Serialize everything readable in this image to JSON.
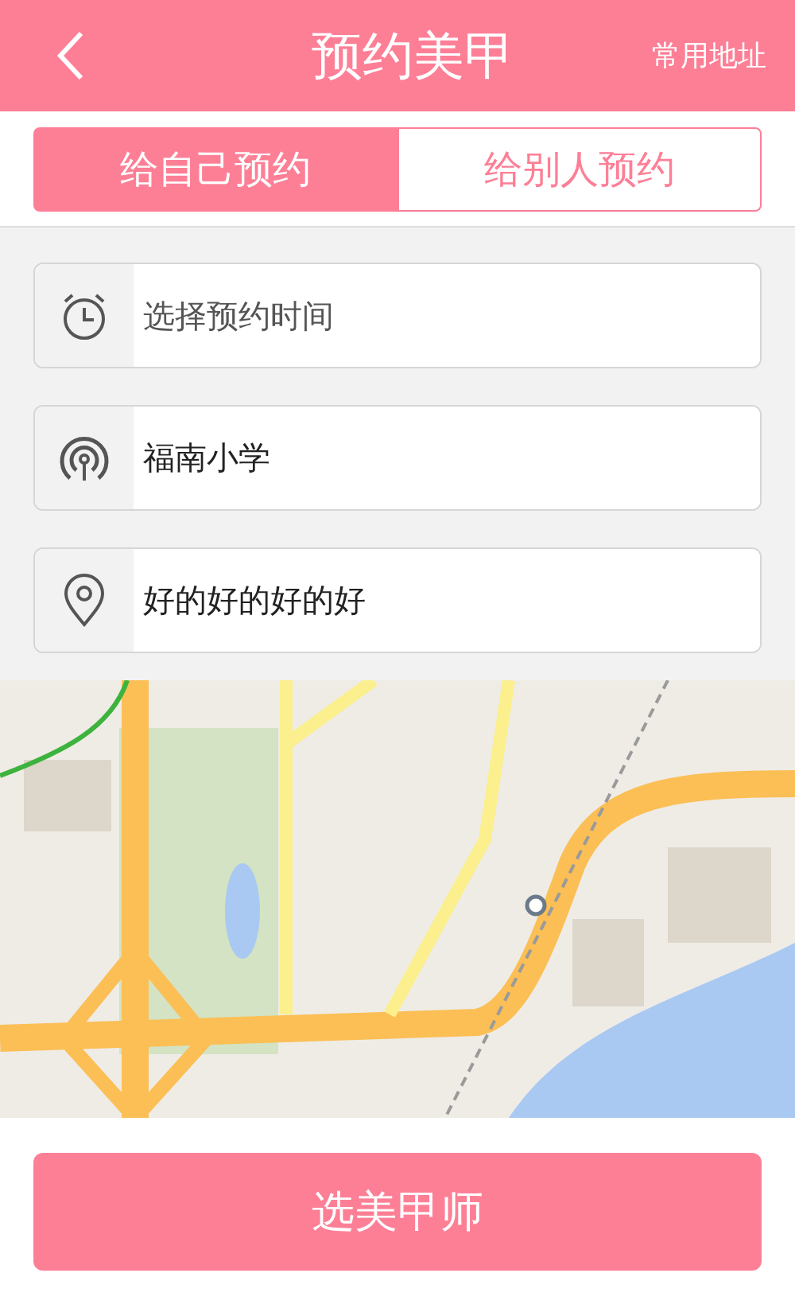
{
  "header": {
    "title": "预约美甲",
    "action": "常用地址"
  },
  "tabs": [
    {
      "label": "给自己预约",
      "selected": true
    },
    {
      "label": "给别人预约",
      "selected": false
    }
  ],
  "fields": [
    {
      "kind": "clock",
      "placeholder": "选择预约时间"
    },
    {
      "kind": "signal",
      "value": "福南小学"
    },
    {
      "kind": "pin",
      "value": "好的好的好的好"
    }
  ],
  "submit": "选美甲师"
}
